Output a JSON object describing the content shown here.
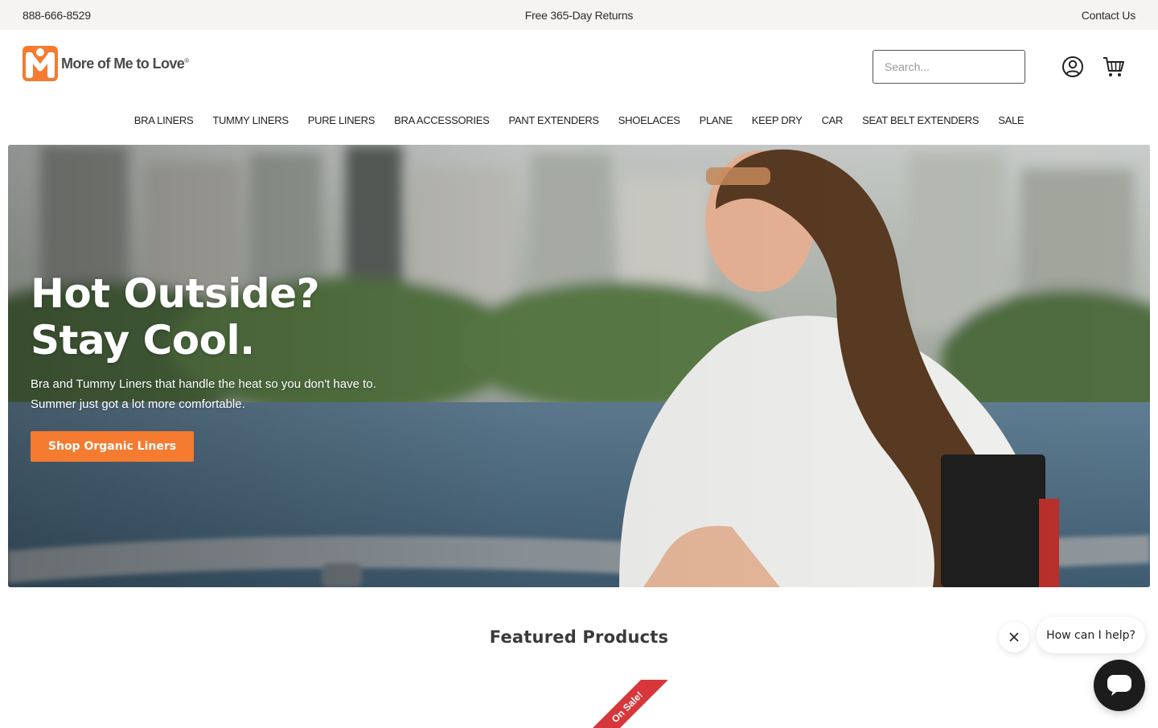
{
  "topbar": {
    "phone": "888-666-8529",
    "promo": "Free 365-Day Returns",
    "contact": "Contact Us"
  },
  "brand": {
    "name": "More of Me to Love",
    "trademark": "®",
    "accent": "#f47b30"
  },
  "search": {
    "placeholder": "Search..."
  },
  "icons": {
    "account": "user-circle-icon",
    "cart": "shopping-cart-icon"
  },
  "nav": {
    "items": [
      {
        "label": "BRA LINERS"
      },
      {
        "label": "TUMMY LINERS"
      },
      {
        "label": "PURE LINERS"
      },
      {
        "label": "BRA ACCESSORIES"
      },
      {
        "label": "PANT EXTENDERS"
      },
      {
        "label": "SHOELACES"
      },
      {
        "label": "PLANE"
      },
      {
        "label": "KEEP DRY"
      },
      {
        "label": "CAR"
      },
      {
        "label": "SEAT BELT EXTENDERS"
      },
      {
        "label": "SALE"
      }
    ]
  },
  "hero": {
    "title_line1": "Hot Outside?",
    "title_line2": "Stay Cool.",
    "subtitle": "Bra and Tummy Liners that handle the heat so you don't have to. Summer just got a lot more comfortable.",
    "cta": "Shop Organic Liners"
  },
  "featured": {
    "heading": "Featured Products",
    "ribbon": "On Sale!",
    "ribbon_color": "#d6373b"
  },
  "chat": {
    "prompt": "How can I help?",
    "launcher_color": "#1c1c1c"
  }
}
